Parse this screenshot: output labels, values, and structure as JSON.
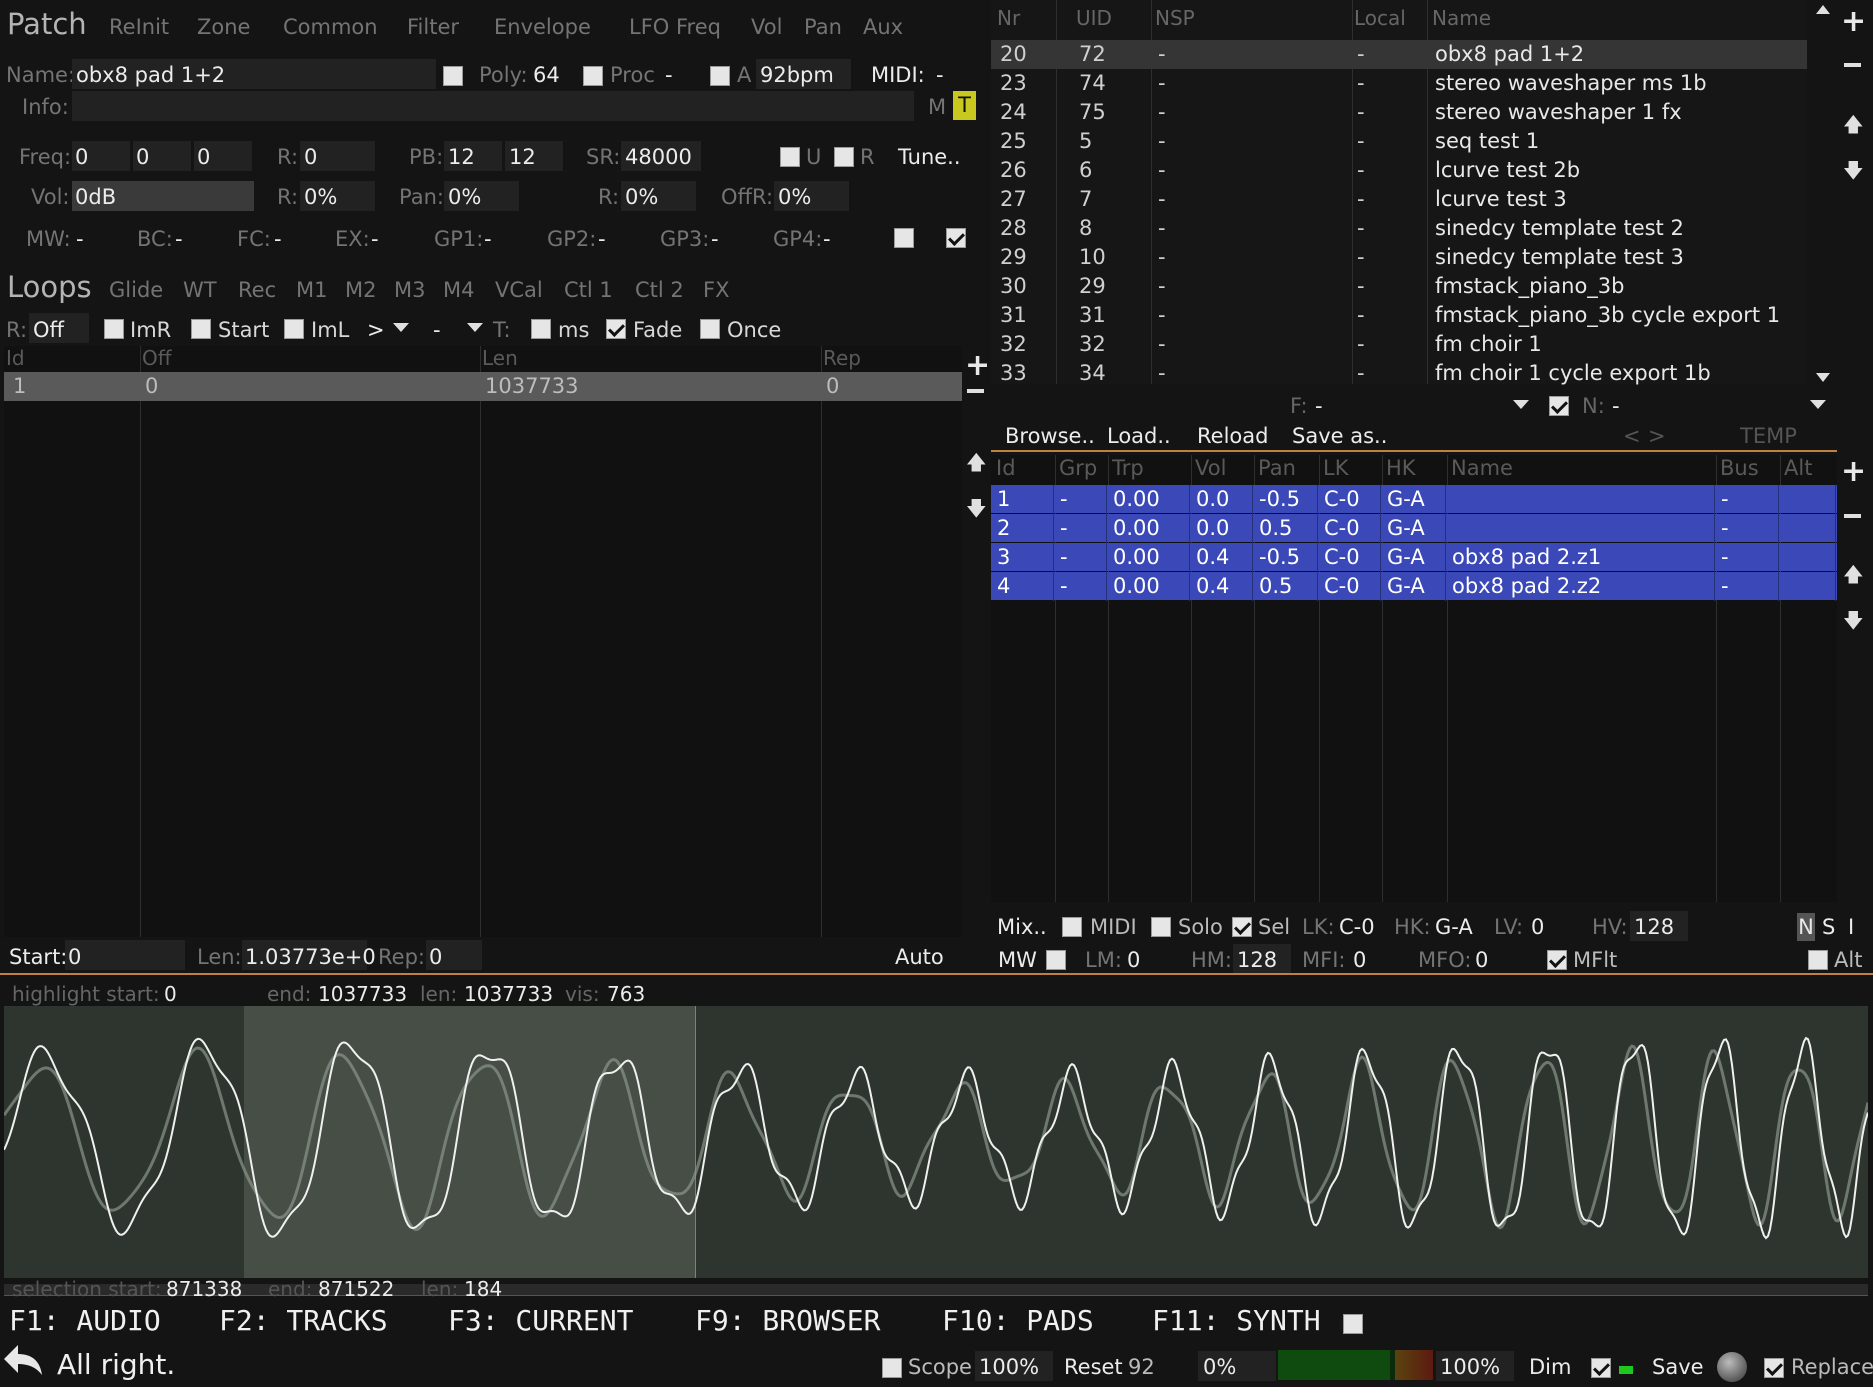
{
  "patch": {
    "title": "Patch",
    "tabs": [
      "ReInit",
      "Zone",
      "Common",
      "Filter",
      "Envelope",
      "LFO Freq",
      "Vol",
      "Pan",
      "Aux"
    ],
    "name_label": "Name:",
    "name_value": "obx8 pad 1+2",
    "poly_label": "Poly:",
    "poly_value": "64",
    "proc_label": "Proc",
    "proc_value": "-",
    "a_label": "A",
    "bpm_value": "92bpm",
    "midi_label": "MIDI:",
    "midi_value": "-",
    "info_label": "Info:",
    "m_label": "M",
    "t_label": "T",
    "freq_label": "Freq:",
    "freq_values": [
      "0",
      "0",
      "0"
    ],
    "r1_label": "R:",
    "r1_value": "0",
    "pb_label": "PB:",
    "pb_values": [
      "12",
      "12"
    ],
    "sr_label": "SR:",
    "sr_value": "48000",
    "u_label": "U",
    "r_label": "R",
    "tune_label": "Tune..",
    "vol_label": "Vol:",
    "vol_value": "0dB",
    "r2_label": "R:",
    "r2_value": "0%",
    "pan_label": "Pan:",
    "pan_value": "0%",
    "r3_label": "R:",
    "r3_value": "0%",
    "offr_label": "OffR:",
    "offr_value": "0%",
    "mods": [
      {
        "label": "MW:",
        "value": "-"
      },
      {
        "label": "BC:",
        "value": "-"
      },
      {
        "label": "FC:",
        "value": "-"
      },
      {
        "label": "EX:",
        "value": "-"
      },
      {
        "label": "GP1:",
        "value": "-"
      },
      {
        "label": "GP2:",
        "value": "-"
      },
      {
        "label": "GP3:",
        "value": "-"
      },
      {
        "label": "GP4:",
        "value": "-"
      }
    ]
  },
  "loops": {
    "title": "Loops",
    "tabs": [
      "Glide",
      "WT",
      "Rec",
      "M1",
      "M2",
      "M3",
      "M4",
      "VCal",
      "Ctl 1",
      "Ctl 2",
      "FX"
    ],
    "r_label": "R:",
    "r_value": "Off",
    "imr": "ImR",
    "start": "Start",
    "iml": "ImL",
    "gt": ">",
    "dash": "-",
    "t_label": "T:",
    "ms": "ms",
    "fade": "Fade",
    "once": "Once",
    "headers": [
      "Id",
      "Off",
      "Len",
      "Rep"
    ],
    "rows": [
      [
        "1",
        "0",
        "1037733",
        "0"
      ]
    ],
    "start_label": "Start:",
    "start_value": "0",
    "len_label": "Len:",
    "len_value": "1.03773e+0",
    "rep_label": "Rep:",
    "rep_value": "0",
    "auto": "Auto"
  },
  "browser": {
    "headers": [
      "Nr",
      "UID",
      "NSP",
      "Local",
      "Name"
    ],
    "rows": [
      [
        "20",
        "72",
        "-",
        "-",
        "obx8 pad 1+2"
      ],
      [
        "23",
        "74",
        "-",
        "-",
        "stereo waveshaper ms 1b"
      ],
      [
        "24",
        "75",
        "-",
        "-",
        "stereo waveshaper 1 fx"
      ],
      [
        "25",
        "5",
        "-",
        "-",
        "seq test 1"
      ],
      [
        "26",
        "6",
        "-",
        "-",
        "lcurve test 2b"
      ],
      [
        "27",
        "7",
        "-",
        "-",
        "lcurve test 3"
      ],
      [
        "28",
        "8",
        "-",
        "-",
        "sinedcy template test 2"
      ],
      [
        "29",
        "10",
        "-",
        "-",
        "sinedcy template test 3"
      ],
      [
        "30",
        "29",
        "-",
        "-",
        "fmstack_piano_3b"
      ],
      [
        "31",
        "31",
        "-",
        "-",
        "fmstack_piano_3b cycle export 1"
      ],
      [
        "32",
        "32",
        "-",
        "-",
        "fm choir 1"
      ],
      [
        "33",
        "34",
        "-",
        "-",
        "fm choir 1 cycle export 1b"
      ]
    ],
    "f_label": "F:",
    "f_value": "-",
    "n_label": "N:",
    "n_value": "-",
    "browse": "Browse..",
    "load": "Load..",
    "reload": "Reload",
    "saveas": "Save as..",
    "lt": "<",
    "gt": ">",
    "temp": "TEMP"
  },
  "zones": {
    "headers": [
      "Id",
      "Grp",
      "Trp",
      "Vol",
      "Pan",
      "LK",
      "HK",
      "Name",
      "Bus",
      "Alt"
    ],
    "rows": [
      [
        "1",
        "-",
        "0.00",
        "0.0",
        "-0.5",
        "C-0",
        "G-A",
        "",
        "-",
        ""
      ],
      [
        "2",
        "-",
        "0.00",
        "0.0",
        "0.5",
        "C-0",
        "G-A",
        "",
        "-",
        ""
      ],
      [
        "3",
        "-",
        "0.00",
        "0.4",
        "-0.5",
        "C-0",
        "G-A",
        "obx8 pad 2.z1",
        "-",
        ""
      ],
      [
        "4",
        "-",
        "0.00",
        "0.4",
        "0.5",
        "C-0",
        "G-A",
        "obx8 pad 2.z2",
        "-",
        ""
      ]
    ],
    "mix": "Mix..",
    "midi": "MIDI",
    "solo": "Solo",
    "sel": "Sel",
    "lk_label": "LK:",
    "lk_value": "C-0",
    "hk_label": "HK:",
    "hk_value": "G-A",
    "lv_label": "LV:",
    "lv_value": "0",
    "hv_label": "HV:",
    "hv_value": "128",
    "n": "N",
    "s": "S",
    "i": "I",
    "mw": "MW",
    "lm_label": "LM:",
    "lm_value": "0",
    "hm_label": "HM:",
    "hm_value": "128",
    "mfi_label": "MFI:",
    "mfi_value": "0",
    "mfo_label": "MFO:",
    "mfo_value": "0",
    "mflt": "MFlt",
    "alt": "Alt"
  },
  "waveform": {
    "hl_label": "highlight start:",
    "hl_start": "0",
    "end_label": "end:",
    "end_value": "1037733",
    "len_label": "len:",
    "len_value": "1037733",
    "vis_label": "vis:",
    "vis_value": "763",
    "sel_label": "selection start:",
    "sel_start": "871338",
    "sel_end_label": "end:",
    "sel_end": "871522",
    "sel_len_label": "len:",
    "sel_len": "184"
  },
  "fkeys": [
    "F1: AUDIO",
    "F2: TRACKS",
    "F3: CURRENT",
    "F9: BROWSER",
    "F10: PADS",
    "F11: SYNTH"
  ],
  "status": {
    "message": "All right.",
    "scope": "Scope",
    "scope_value": "100%",
    "reset": "Reset",
    "reset_value": "92",
    "pct": "0%",
    "meter_pct": "100%",
    "dim": "Dim",
    "save": "Save",
    "replace": "Replace",
    "meter_level": 0.72
  },
  "colors": {
    "accent": "#c08040",
    "sel_row": "#3a48b8",
    "yellow": "#c8c81e",
    "wave_bg": "#2e352e",
    "wave_hl": "#464e46"
  }
}
